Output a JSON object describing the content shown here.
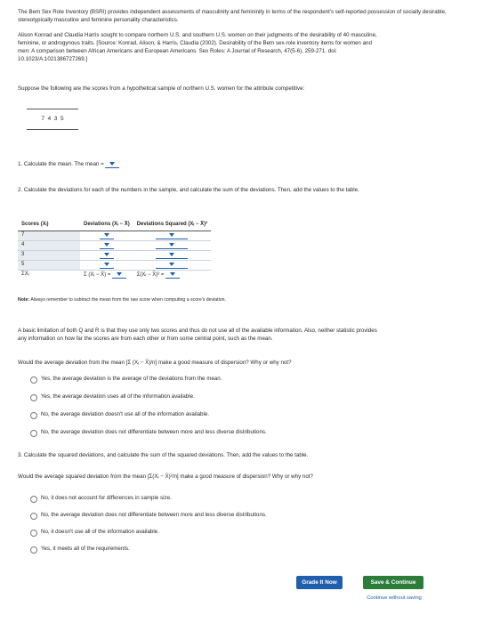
{
  "intro_paragraph": "The Bem Sex Role Inventory (BSRI) provides independent assessments of masculinity and femininity in terms of the respondent's self-reported possession of socially desirable, stereotypically masculine and feminine personality characteristics.",
  "study_line1": "Alison Konrad and Claudia Harris sought to compare northern U.S. and southern U.S. women on their judgments of the desirability of 40 masculine,",
  "study_line2": "feminine, or androgynous traits. [Source: Konrad, Alison, & Harris, Claudia (2002). Desirability of the Bem sex-role inventory items for women and",
  "study_line3": "men: A comparison between African Americans and European Americans. Sex Roles: A Journal of Research, 47(5-6), 259-271. doi:",
  "study_line4": "10.1023/A:1021386727269.]",
  "suppose_text": "Suppose the following are the scores from a hypothetical sample of northern U.S. women for the attribute competitive:",
  "scores_display": "7  4  3  5",
  "q1_text": "1. Calculate the mean. The mean =",
  "q2_text": "2. Calculate the deviations for each of the numbers in the sample, and calculate the sum of the deviations. Then, add the values to the table.",
  "table": {
    "headers": [
      "Scores (Xᵢ)",
      "Deviations (Xᵢ − X̄)",
      "Deviations Squared (Xᵢ − X̄)²"
    ],
    "scores": [
      "7",
      "4",
      "3",
      "5"
    ],
    "sum_x_label": "ΣXᵢ",
    "sum_dev_label": "Σ (Xᵢ − X̄) =",
    "sum_sq_label": "Σ(Xᵢ − X̄)² ="
  },
  "note_label": "Note:",
  "note_text": "Always remember to subtract the mean from the raw score when computing a score's deviation.",
  "limitation_line1": "A basic limitation of both Q and R is that they use only two scores and thus do not use all of the available information. Also, neither statistic provides",
  "limitation_line2": "any information on how far the scores are from each other or from some central point, such as the mean.",
  "avg_dev_question": "Would the average deviation from the mean [Σ (Xᵢ − X̄)/n] make a good measure of dispersion? Why or why not?",
  "avg_dev_options": [
    "Yes, the average deviation is the average of the deviations from the mean.",
    "Yes, the average deviation uses all of the information available.",
    "No, the average deviation doesn't use all of the information available.",
    "No, the average deviation does not differentiate between more and less diverse distributions."
  ],
  "q3_text": "3. Calculate the squared deviations, and calculate the sum of the squared deviations. Then, add the values to the table.",
  "sq_question": "Would the average squared deviation from the mean [Σ(Xᵢ − X̄)²/n] make a good measure of dispersion? Why or why not?",
  "sq_options": [
    "No, it does not account for differences in sample size.",
    "No, the average deviation does not differentiate between more and less diverse distributions.",
    "No, it doesn't use all of the information available.",
    "Yes, it meets all of the requirements."
  ],
  "buttons": {
    "grade_label": "Grade It Now",
    "save_label": "Save & Continue",
    "continue_link": "Continue without saving"
  },
  "colors": {
    "primary_button": "#1f5fae",
    "secondary_button": "#2c7c3a",
    "dropdown": "#1f5fae"
  }
}
